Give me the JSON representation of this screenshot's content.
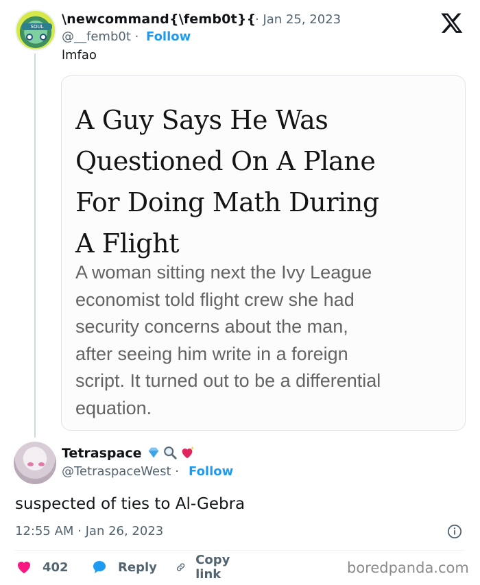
{
  "tweet": {
    "author_name": "\\newcommand{\\femb0t}{",
    "date_separator": "·",
    "date": "Jan 25, 2023",
    "handle": "@__femb0t",
    "follow_separator": "·",
    "follow_label": "Follow",
    "text": "lmfao",
    "avatar_band_text": "SOUL",
    "image": {
      "headline": "A Guy Says He Was\nQuestioned On A Plane\nFor Doing Math During\nA Flight",
      "subtext": "A woman sitting next the Ivy League\neconomist told flight crew she had\nsecurity concerns about the man,\nafter seeing him write in a foreign\nscript. It turned out to be a differential\nequation."
    }
  },
  "reply": {
    "author_name": "Tetraspace",
    "badges": [
      "gem-icon",
      "magnifier-icon",
      "sparkling-heart-icon"
    ],
    "handle": "@TetraspaceWest",
    "follow_separator": "·",
    "follow_label": "Follow",
    "text": "suspected of ties to Al-Gebra",
    "timestamp": "12:55 AM · Jan 26, 2023"
  },
  "actions": {
    "like_count": "402",
    "reply_label": "Reply",
    "copy_label": "Copy link"
  },
  "icons": {
    "platform": "x-logo-icon",
    "info": "info-icon",
    "like": "heart-icon",
    "reply": "speech-bubble-icon",
    "copy": "link-icon"
  },
  "colors": {
    "accent": "#1d9bf0",
    "like": "#f91880",
    "secondary_text": "#536471"
  },
  "watermark": "boredpanda.com"
}
